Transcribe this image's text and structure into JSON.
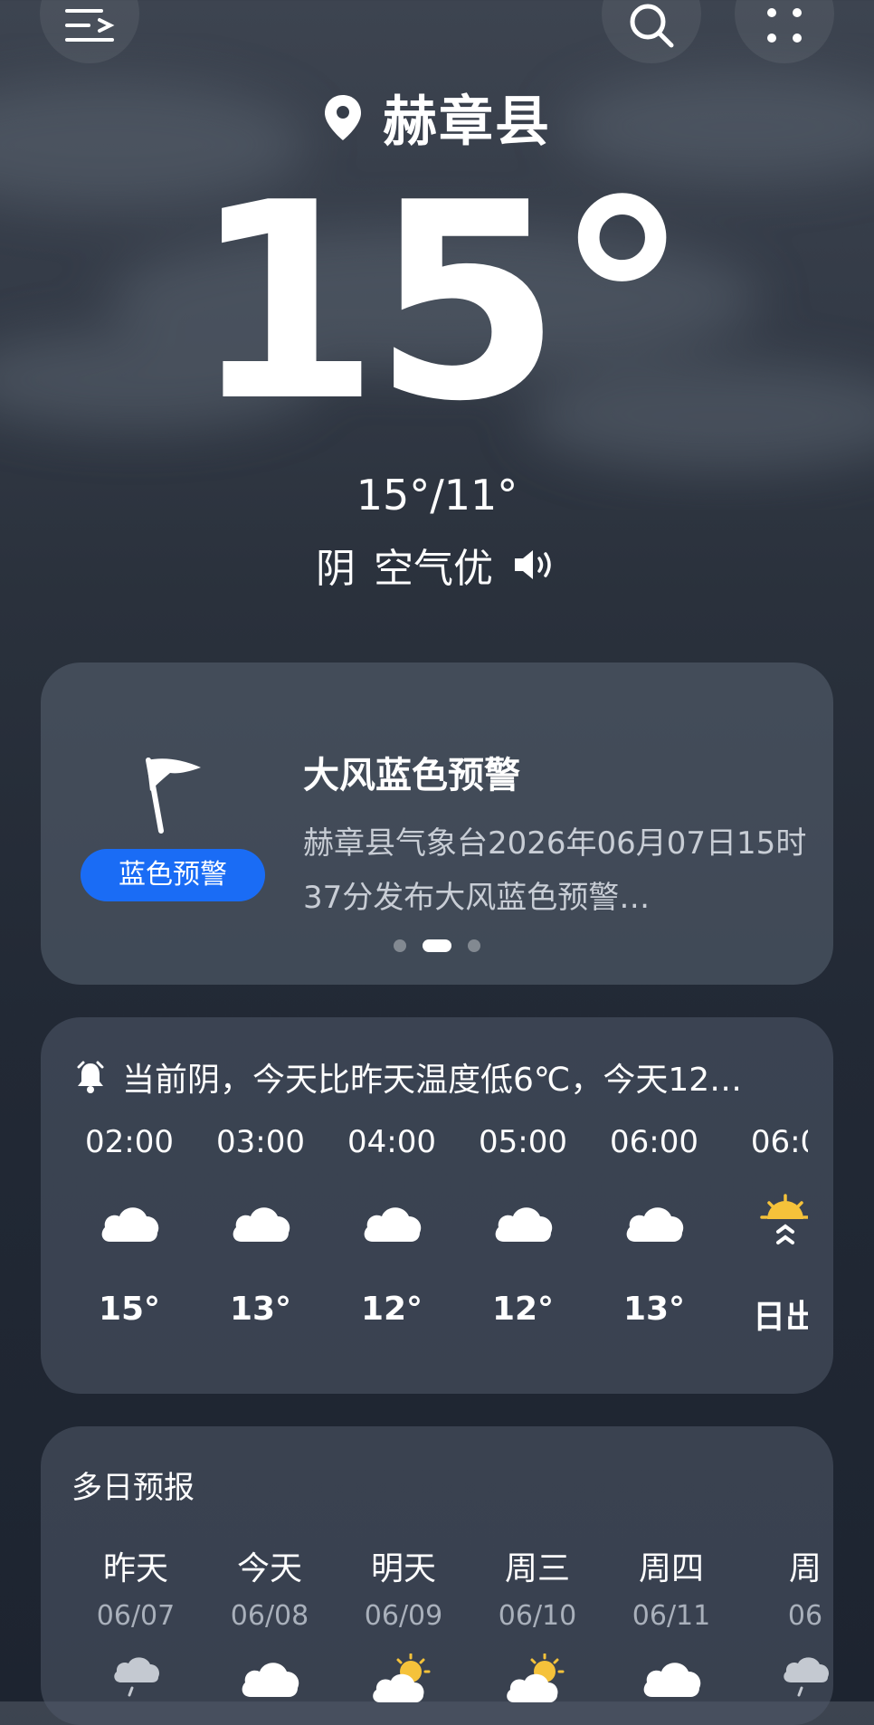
{
  "location": {
    "name": "赫章县"
  },
  "current": {
    "temp": "15°",
    "hilo": "15°/11°",
    "condition": "阴",
    "air": "空气优"
  },
  "alert": {
    "badge": "蓝色预警",
    "title": "大风蓝色预警",
    "body": "赫章县气象台2026年06月07日15时37分发布大风蓝色预警…"
  },
  "hourly": {
    "summary": "当前阴，今天比昨天温度低6℃，今天12…",
    "items": [
      {
        "time": "02:00",
        "icon": "cloud-icon",
        "temp": "15°"
      },
      {
        "time": "03:00",
        "icon": "cloud-icon",
        "temp": "13°"
      },
      {
        "time": "04:00",
        "icon": "cloud-icon",
        "temp": "12°"
      },
      {
        "time": "05:00",
        "icon": "cloud-icon",
        "temp": "12°"
      },
      {
        "time": "06:00",
        "icon": "cloud-icon",
        "temp": "13°"
      },
      {
        "time": "06:0",
        "icon": "sunrise-icon",
        "temp": "日出"
      }
    ]
  },
  "daily": {
    "title": "多日预报",
    "items": [
      {
        "day": "昨天",
        "date": "06/07",
        "icon": "rain-cloud-icon"
      },
      {
        "day": "今天",
        "date": "06/08",
        "icon": "cloud-icon"
      },
      {
        "day": "明天",
        "date": "06/09",
        "icon": "partly-sunny-icon"
      },
      {
        "day": "周三",
        "date": "06/10",
        "icon": "partly-sunny-icon"
      },
      {
        "day": "周四",
        "date": "06/11",
        "icon": "cloud-icon"
      },
      {
        "day": "周",
        "date": "06",
        "icon": "rain-cloud-icon"
      }
    ]
  },
  "colors": {
    "accent": "#1a6cf5",
    "sun": "#f5c23a"
  }
}
